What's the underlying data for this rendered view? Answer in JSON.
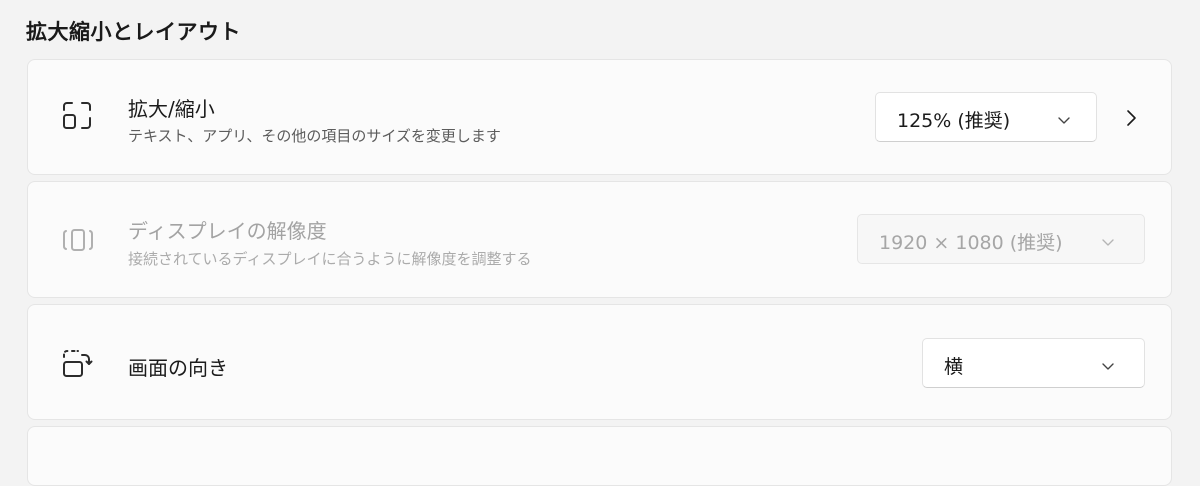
{
  "section": {
    "title": "拡大縮小とレイアウト"
  },
  "scale": {
    "title": "拡大/縮小",
    "description": "テキスト、アプリ、その他の項目のサイズを変更します",
    "value": "125% (推奨)",
    "icon": "scale-icon"
  },
  "resolution": {
    "title": "ディスプレイの解像度",
    "description": "接続されているディスプレイに合うように解像度を調整する",
    "value": "1920 × 1080 (推奨)",
    "icon": "resolution-icon",
    "disabled": true
  },
  "orientation": {
    "title": "画面の向き",
    "value": "横",
    "icon": "orientation-icon"
  },
  "colors": {
    "background": "#f3f3f3",
    "card": "#fbfbfb",
    "text": "#1b1b1b",
    "secondary_text": "#5c5c5c",
    "disabled_text": "#a3a3a3"
  }
}
